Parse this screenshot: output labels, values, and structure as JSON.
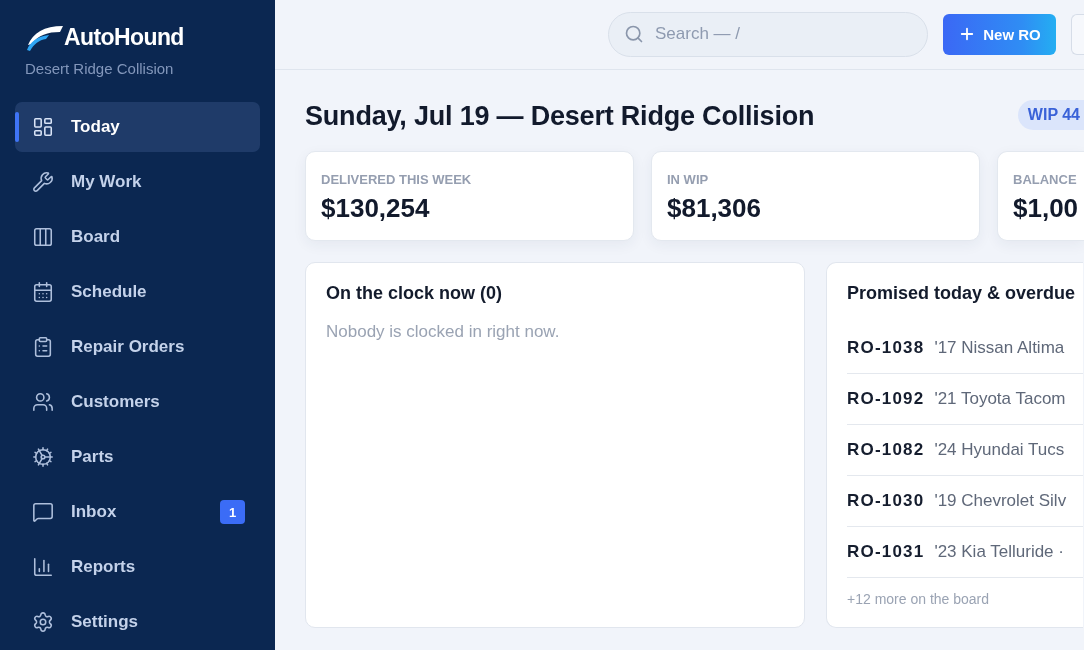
{
  "sidebar": {
    "brand": "AutoHound",
    "subtitle": "Desert Ridge Collision",
    "items": [
      {
        "label": "Today",
        "selected": true
      },
      {
        "label": "My Work",
        "selected": false
      },
      {
        "label": "Board",
        "selected": false
      },
      {
        "label": "Schedule",
        "selected": false
      },
      {
        "label": "Repair Orders",
        "selected": false
      },
      {
        "label": "Customers",
        "selected": false
      },
      {
        "label": "Parts",
        "selected": false
      },
      {
        "label": "Inbox",
        "selected": false,
        "badge": "1"
      },
      {
        "label": "Reports",
        "selected": false
      },
      {
        "label": "Settings",
        "selected": false
      }
    ]
  },
  "topbar": {
    "search": {
      "placeholder": "Search — /"
    },
    "new_button": "New RO"
  },
  "header": {
    "title": "Sunday, Jul 19 — Desert Ridge Collision",
    "wip_badge": "WIP 44"
  },
  "stats": [
    {
      "label": "DELIVERED THIS WEEK",
      "value": "$130,254"
    },
    {
      "label": "IN WIP",
      "value": "$81,306"
    },
    {
      "label": "BALANCE",
      "value": "$1,00"
    }
  ],
  "clock_panel": {
    "title": "On the clock now (0)",
    "empty_message": "Nobody is clocked in right now."
  },
  "promised_panel": {
    "title": "Promised today & overdue",
    "rows": [
      {
        "ro": "RO-1038",
        "vehicle": "'17 Nissan Altima"
      },
      {
        "ro": "RO-1092",
        "vehicle": "'21 Toyota Tacom"
      },
      {
        "ro": "RO-1082",
        "vehicle": "'24 Hyundai Tucs"
      },
      {
        "ro": "RO-1030",
        "vehicle": "'19 Chevrolet Silv"
      },
      {
        "ro": "RO-1031",
        "vehicle": "'23 Kia Telluride ·"
      }
    ],
    "footer": "+12 more on the board"
  }
}
